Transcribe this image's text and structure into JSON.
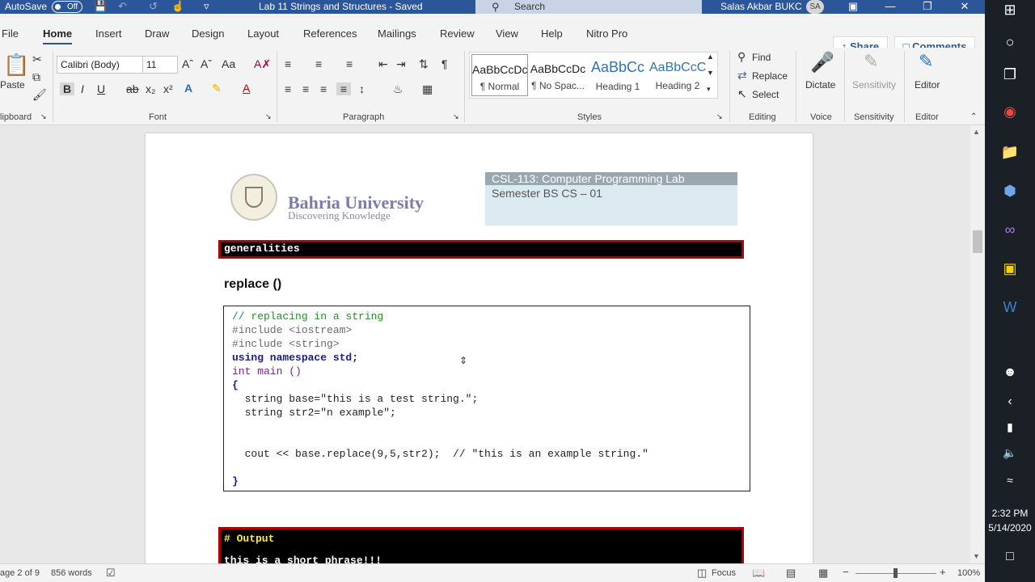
{
  "titlebar": {
    "autosave_label": "AutoSave",
    "autosave_state": "Off",
    "doc_title": "Lab 11 Strings and Structures  -  Saved",
    "search_placeholder": "Search",
    "user_name": "Salas Akbar BUKC",
    "user_initials": "SA"
  },
  "menu": {
    "tabs": [
      "File",
      "Home",
      "Insert",
      "Draw",
      "Design",
      "Layout",
      "References",
      "Mailings",
      "Review",
      "View",
      "Help",
      "Nitro Pro"
    ],
    "active_tab": "Home",
    "share_label": "Share",
    "comments_label": "Comments"
  },
  "ribbon": {
    "clipboard": {
      "paste_label": "Paste",
      "group_label": "lipboard"
    },
    "font": {
      "font_name": "Calibri (Body)",
      "font_size": "11",
      "group_label": "Font"
    },
    "paragraph": {
      "group_label": "Paragraph"
    },
    "styles": {
      "items": [
        {
          "preview": "AaBbCcDc",
          "name": "¶ Normal"
        },
        {
          "preview": "AaBbCcDc",
          "name": "¶ No Spac..."
        },
        {
          "preview": "AaBbCc",
          "name": "Heading 1"
        },
        {
          "preview": "AaBbCcC",
          "name": "Heading 2"
        }
      ],
      "group_label": "Styles"
    },
    "editing": {
      "find_label": "Find",
      "replace_label": "Replace",
      "select_label": "Select",
      "group_label": "Editing"
    },
    "voice": {
      "dictate_label": "Dictate",
      "group_label": "Voice"
    },
    "sensitivity": {
      "label": "Sensitivity",
      "group_label": "Sensitivity"
    },
    "editor": {
      "label": "Editor",
      "group_label": "Editor"
    }
  },
  "document": {
    "university_name": "Bahria University",
    "university_tagline": "Discovering Knowledge",
    "course_title": "CSL-113: Computer Programming Lab",
    "semester": "Semester BS CS – 01",
    "section_bar_text": "generalities",
    "section_title": "replace ()",
    "code_lines": [
      "// replacing in a string",
      "#include <iostream>",
      "#include <string>",
      "using namespace std;",
      "int main ()",
      "{",
      "  string base=\"this is a test string.\";",
      "  string str2=\"n example\";",
      "",
      "",
      "  cout << base.replace(9,5,str2);  // \"this is an example string.\"",
      "",
      "}"
    ],
    "output_header": "# Output",
    "output_text": "this is a short phrase!!!"
  },
  "statusbar": {
    "page_info": "age 2 of 9",
    "word_count": "856 words",
    "focus_label": "Focus",
    "zoom_level": "100%"
  },
  "taskbar": {
    "time": "2:32 PM",
    "date": "5/14/2020"
  },
  "colors": {
    "title_bar": "#2b579a",
    "code_comment": "#2e8b2e",
    "code_keyword": "#1a1a8c",
    "output_header": "#ffee33",
    "bar_border": "#b20000"
  }
}
